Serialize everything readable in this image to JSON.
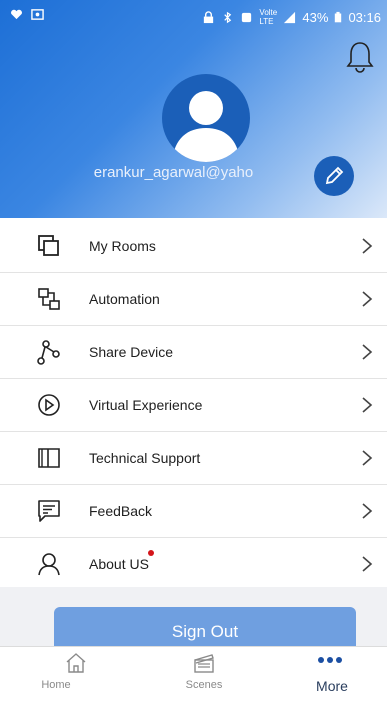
{
  "status_bar": {
    "battery": "43%",
    "time": "03:16",
    "network": "Volte LTE"
  },
  "profile": {
    "email": "erankur_agarwal@yaho"
  },
  "menu": {
    "items": [
      {
        "label": "My Rooms",
        "icon": "rooms-icon"
      },
      {
        "label": "Automation",
        "icon": "automation-icon"
      },
      {
        "label": "Share Device",
        "icon": "share-icon"
      },
      {
        "label": "Virtual Experience",
        "icon": "play-circle-icon"
      },
      {
        "label": "Technical Support",
        "icon": "book-icon"
      },
      {
        "label": "FeedBack",
        "icon": "feedback-icon"
      },
      {
        "label": "About US",
        "icon": "user-icon"
      }
    ]
  },
  "sign_out_label": "Sign Out",
  "tabbar": {
    "home": "Home",
    "scenes": "Scenes",
    "more": "More"
  },
  "colors": {
    "header_gradient_start": "#1d6fd6",
    "accent": "#1b5fb8",
    "sign_out_bg": "#6f9fe0",
    "notification_dot": "#d4151a"
  }
}
